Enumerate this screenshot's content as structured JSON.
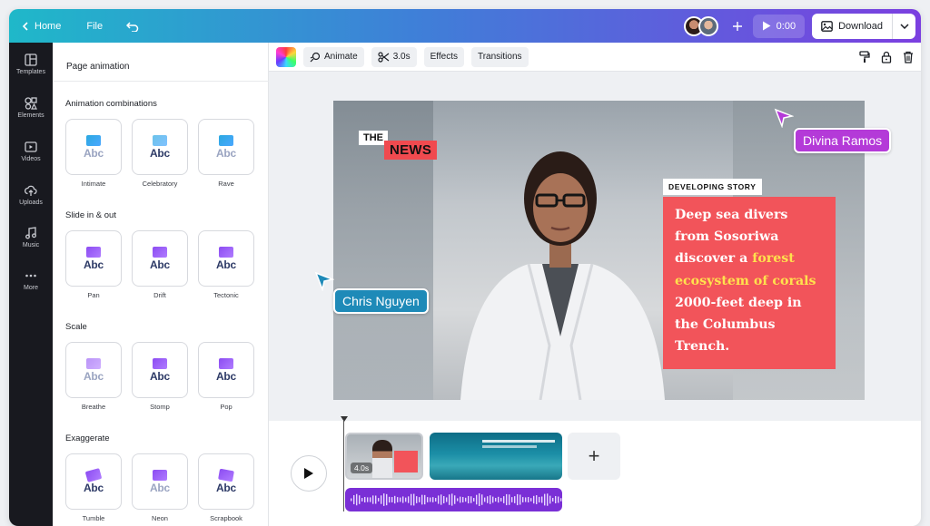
{
  "topbar": {
    "home_label": "Home",
    "file_label": "File",
    "time": "0:00",
    "download_label": "Download"
  },
  "rail": {
    "items": [
      {
        "label": "Templates",
        "icon": "layout-icon"
      },
      {
        "label": "Elements",
        "icon": "shapes-icon"
      },
      {
        "label": "Videos",
        "icon": "video-icon"
      },
      {
        "label": "Uploads",
        "icon": "cloud-upload-icon"
      },
      {
        "label": "Music",
        "icon": "music-note-icon"
      },
      {
        "label": "More",
        "icon": "more-dots-icon"
      }
    ]
  },
  "panel": {
    "title": "Page animation",
    "sections": [
      {
        "title": "Animation combinations",
        "items": [
          "Intimate",
          "Celebratory",
          "Rave"
        ]
      },
      {
        "title": "Slide in & out",
        "items": [
          "Pan",
          "Drift",
          "Tectonic"
        ]
      },
      {
        "title": "Scale",
        "items": [
          "Breathe",
          "Stomp",
          "Pop"
        ]
      },
      {
        "title": "Exaggerate",
        "items": [
          "Tumble",
          "Neon",
          "Scrapbook"
        ]
      }
    ],
    "tile_text": "Abc"
  },
  "toolbar": {
    "animate_label": "Animate",
    "duration_label": "3.0s",
    "effects_label": "Effects",
    "transitions_label": "Transitions"
  },
  "canvas": {
    "the_label": "THE",
    "news_label": "NEWS",
    "developing_label": "DEVELOPING STORY",
    "story_part1": "Deep sea divers from Sosoriwa discover a ",
    "story_highlight": "forest ecosystem of corals",
    "story_part2": " 2000-feet deep in the Columbus Trench."
  },
  "collaborators": {
    "divina": "Divina Ramos",
    "chris": "Chris Nguyen"
  },
  "timeline": {
    "clip1_duration": "4.0s",
    "add_label": "+"
  },
  "colors": {
    "topbar_start": "#1fb8c9",
    "topbar_end": "#7b3fe0",
    "news_red": "#f04a4f",
    "story_box": "#f2545a",
    "highlight": "#ffe14d",
    "divina": "#b43ad8",
    "chris": "#1e8ab8",
    "audio": "#7a2fd6"
  }
}
